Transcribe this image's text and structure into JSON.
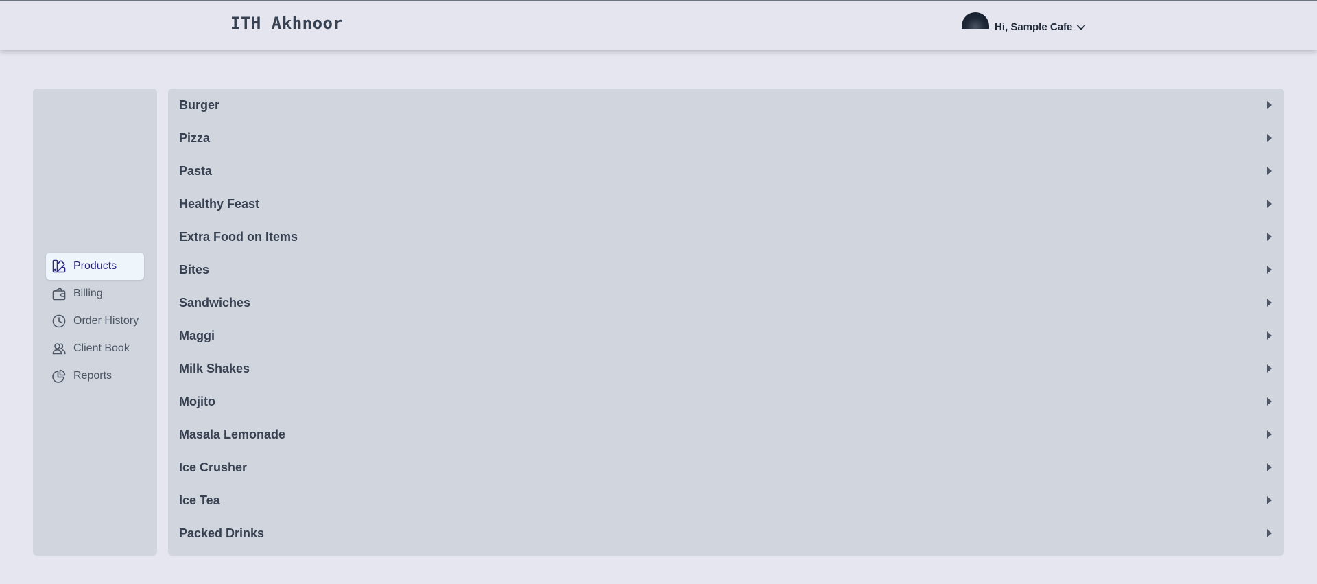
{
  "header": {
    "brand": "ITH Akhnoor",
    "greeting": "Hi, Sample Cafe"
  },
  "sidebar": {
    "items": [
      {
        "label": "Products",
        "icon": "products-icon",
        "active": true
      },
      {
        "label": "Billing",
        "icon": "wallet-icon",
        "active": false
      },
      {
        "label": "Order History",
        "icon": "clock-icon",
        "active": false
      },
      {
        "label": "Client Book",
        "icon": "users-icon",
        "active": false
      },
      {
        "label": "Reports",
        "icon": "pie-chart-icon",
        "active": false
      }
    ]
  },
  "categories": [
    "Burger",
    "Pizza",
    "Pasta",
    "Healthy Feast",
    "Extra Food on Items",
    "Bites",
    "Sandwiches",
    "Maggi",
    "Milk Shakes",
    "Mojito",
    "Masala Lemonade",
    "Ice Crusher",
    "Ice Tea",
    "Packed Drinks"
  ],
  "colors": {
    "background": "#e5e6ef",
    "panel": "#d1d5dd",
    "active_nav_bg": "#eff6fb",
    "active_nav_text": "#2a2780"
  }
}
